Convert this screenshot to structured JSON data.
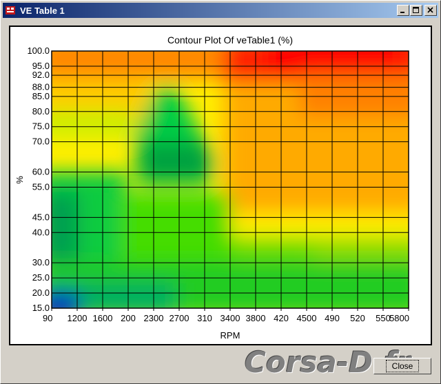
{
  "window": {
    "title": "VE Table 1",
    "icon": "app-chip-icon",
    "buttons": [
      "minimize",
      "maximize",
      "close"
    ]
  },
  "close_button_label": "Close",
  "watermark": "Corsa-D.fr",
  "colors": {
    "title_start": "#0a246a",
    "title_end": "#a6caf0"
  },
  "chart_data": {
    "type": "heatmap",
    "title": "Contour Plot Of veTable1 (%)",
    "xlabel": "RPM",
    "ylabel": "%",
    "x_ticks": [
      "90",
      "1200",
      "1600",
      "2000",
      "2300",
      "2700",
      "3100",
      "3400",
      "3800",
      "4200",
      "4500",
      "4900",
      "5200",
      "5500",
      "5800"
    ],
    "x_tick_labels": [
      "90",
      "1200",
      "1600",
      "200",
      "2300",
      "2700",
      "310",
      "3400",
      "3800",
      "420",
      "4500",
      "490",
      "520",
      "550",
      "5800"
    ],
    "y_ticks": [
      "100.0",
      "95.0",
      "92.0",
      "88.0",
      "85.0",
      "80.0",
      "75.0",
      "70.0",
      "60.0",
      "55.0",
      "45.0",
      "40.0",
      "30.0",
      "25.0",
      "20.0",
      "15.0"
    ],
    "x_range": [
      90,
      5800
    ],
    "y_range": [
      15,
      100
    ],
    "color_scale": [
      "#0022cc",
      "#00cc55",
      "#66ee00",
      "#ffff00",
      "#ffaa00",
      "#ff0000"
    ],
    "grid": true
  }
}
